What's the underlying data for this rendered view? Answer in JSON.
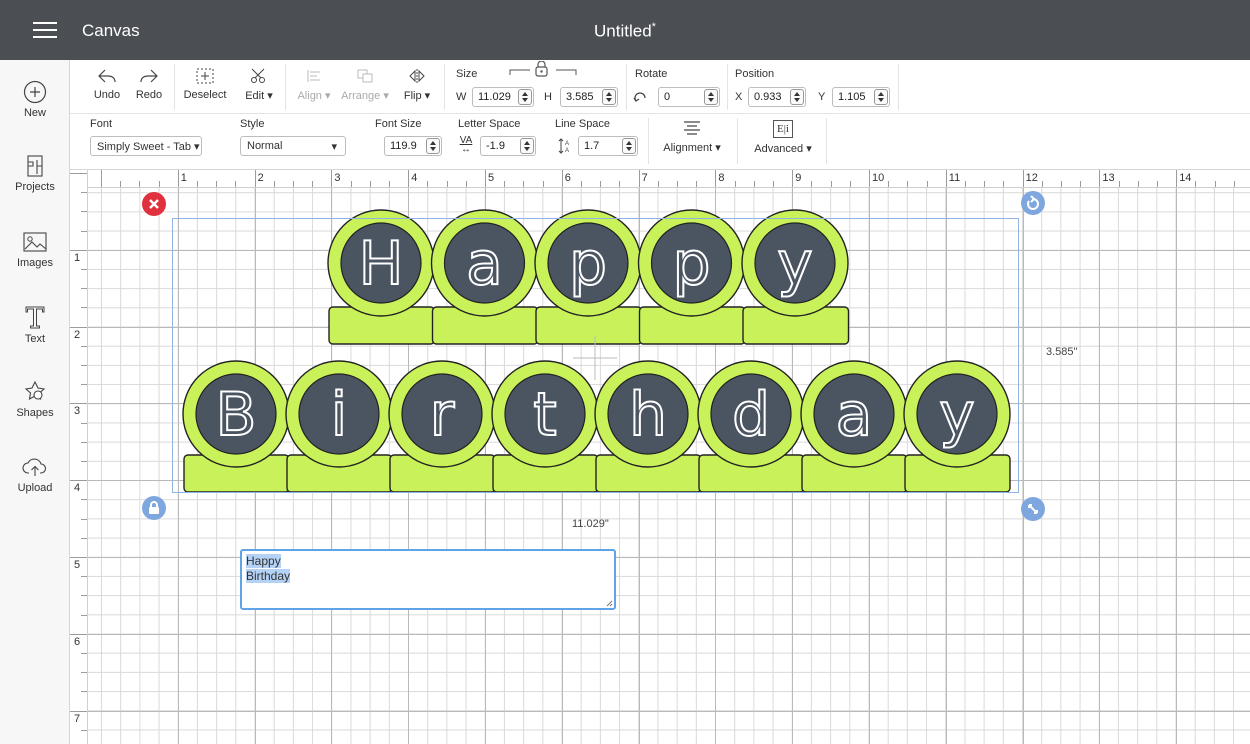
{
  "titlebar": {
    "app_name": "Canvas",
    "doc_title": "Untitled",
    "unsaved_mark": "*"
  },
  "sidebar": {
    "items": [
      {
        "label": "New",
        "icon": "plus-circle-icon"
      },
      {
        "label": "Projects",
        "icon": "projects-icon"
      },
      {
        "label": "Images",
        "icon": "image-icon"
      },
      {
        "label": "Text",
        "icon": "text-icon"
      },
      {
        "label": "Shapes",
        "icon": "shapes-icon"
      },
      {
        "label": "Upload",
        "icon": "cloud-upload-icon"
      }
    ]
  },
  "toolbar": {
    "undo": "Undo",
    "redo": "Redo",
    "deselect": "Deselect",
    "edit": "Edit",
    "align": "Align",
    "arrange": "Arrange",
    "flip": "Flip",
    "size_label": "Size",
    "w_label": "W",
    "w_value": "11.029",
    "h_label": "H",
    "h_value": "3.585",
    "rotate_label": "Rotate",
    "rotate_value": "0",
    "position_label": "Position",
    "x_label": "X",
    "x_value": "0.933",
    "y_label": "Y",
    "y_value": "1.105"
  },
  "textbar": {
    "font_label": "Font",
    "font_value": "Simply Sweet - Tab",
    "style_label": "Style",
    "style_value": "Normal",
    "fontsize_label": "Font Size",
    "fontsize_value": "119.9",
    "letterspace_label": "Letter Space",
    "letterspace_value": "-1.9",
    "letterspace_icon_text": "VA",
    "linespace_label": "Line Space",
    "linespace_value": "1.7",
    "alignment": "Alignment",
    "advanced": "Advanced",
    "advanced_icon_text": "E|i"
  },
  "canvas": {
    "ruler_top": [
      "1",
      "2",
      "3",
      "4",
      "5",
      "6",
      "7",
      "8",
      "9",
      "10",
      "11",
      "12",
      "13",
      "14"
    ],
    "ruler_left": [
      "1",
      "2",
      "3",
      "4",
      "5",
      "6",
      "7"
    ],
    "width_readout": "11.029\"",
    "height_readout": "3.585\"",
    "design": {
      "line1": [
        "H",
        "a",
        "p",
        "p",
        "y"
      ],
      "line2": [
        "B",
        "i",
        "r",
        "t",
        "h",
        "d",
        "a",
        "y"
      ],
      "tag_fill": "#c9f25a",
      "circle_fill": "#4b5561"
    },
    "text_editor": {
      "line1": "Happy",
      "line2": "Birthday"
    }
  }
}
